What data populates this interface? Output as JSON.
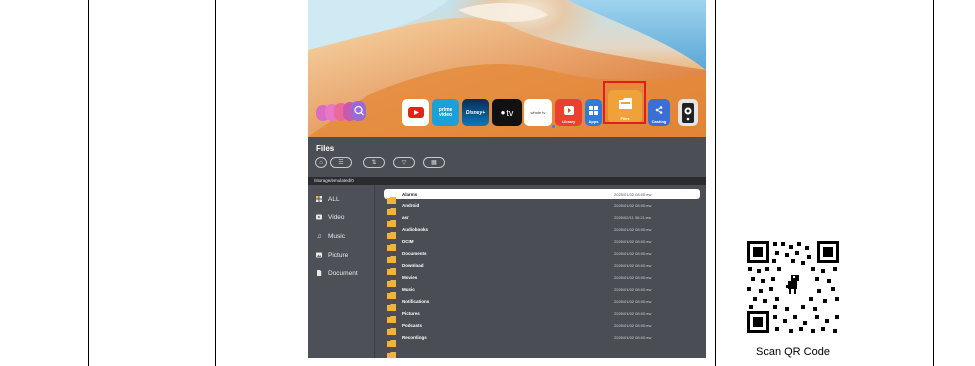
{
  "dock": {
    "apps": [
      {
        "name": "YouTube",
        "label": ""
      },
      {
        "name": "Prime Video",
        "label": "prime video"
      },
      {
        "name": "Disney+",
        "label": "Disney+"
      },
      {
        "name": "Apple TV",
        "label": "tv"
      },
      {
        "name": "Whole TV",
        "label": "whole tv"
      },
      {
        "name": "Library",
        "label": "Library"
      },
      {
        "name": "Apps",
        "label": "Apps"
      },
      {
        "name": "Files",
        "label": "Files"
      },
      {
        "name": "Casting",
        "label": "Casting"
      }
    ]
  },
  "files": {
    "title": "Files",
    "path": "/storage/emulated/0",
    "sidebar": [
      {
        "label": "ALL",
        "icon": "grid-icon"
      },
      {
        "label": "Video",
        "icon": "video-icon"
      },
      {
        "label": "Music",
        "icon": "music-icon"
      },
      {
        "label": "Picture",
        "icon": "picture-icon"
      },
      {
        "label": "Document",
        "icon": "document-icon"
      }
    ],
    "rows": [
      {
        "name": "Alarms",
        "date": "2025/01/02 08:00:ew",
        "selected": true
      },
      {
        "name": "Android",
        "date": "2025/01/02 08:00:ew"
      },
      {
        "name": "asr",
        "date": "2025/02/11 06:21:ew"
      },
      {
        "name": "Audiobooks",
        "date": "2025/01/02 08:00:ew"
      },
      {
        "name": "DCIM",
        "date": "2025/01/02 08:00:ew"
      },
      {
        "name": "Documents",
        "date": "2025/01/02 08:00:ew"
      },
      {
        "name": "Download",
        "date": "2025/01/02 08:00:ew"
      },
      {
        "name": "Movies",
        "date": "2025/01/02 08:00:ew"
      },
      {
        "name": "Music",
        "date": "2025/01/02 08:00:ew"
      },
      {
        "name": "Notifications",
        "date": "2025/01/02 08:00:ew"
      },
      {
        "name": "Pictures",
        "date": "2025/01/02 08:00:ew"
      },
      {
        "name": "Podcasts",
        "date": "2025/01/02 08:00:ew"
      },
      {
        "name": "Recordings",
        "date": "2025/01/02 08:00:ew"
      },
      {
        "name": "",
        "date": ""
      }
    ]
  },
  "qr": {
    "label": "Scan QR Code"
  },
  "colors": {
    "highlight": "#e01e1e",
    "folder": "#f2b33d",
    "accent": "#3b8bd8"
  }
}
